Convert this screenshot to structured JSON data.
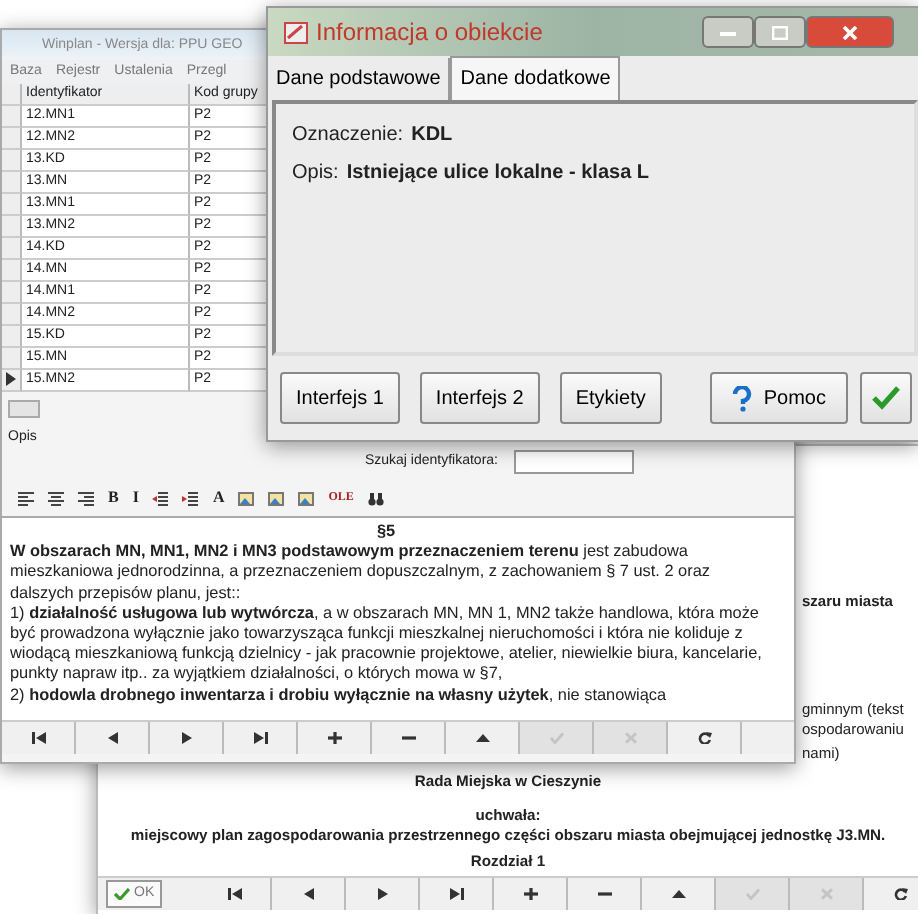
{
  "back_window": {
    "side_texts": [
      {
        "text": "szaru miasta",
        "bold": true
      },
      {
        "text": "gminnym (tekst",
        "bold": false
      },
      {
        "text": "ospodarowaniu",
        "bold": false
      },
      {
        "text": "nami)",
        "bold": false
      }
    ],
    "heading": "Rada Miejska w Cieszynie",
    "resolution_label": "uchwała:",
    "resolution_title": "miejscowy plan zagospodarowania przestrzennego części obszaru miasta obejmującej jednostkę J3.MN.",
    "chapter": "Rozdział 1",
    "ok_button": "OK",
    "nav_buttons": [
      {
        "kind": "first",
        "disabled": false
      },
      {
        "kind": "prev",
        "disabled": false
      },
      {
        "kind": "next",
        "disabled": false
      },
      {
        "kind": "last",
        "disabled": false
      },
      {
        "kind": "add",
        "disabled": false
      },
      {
        "kind": "delete",
        "disabled": false
      },
      {
        "kind": "up",
        "disabled": false
      },
      {
        "kind": "confirm",
        "disabled": true
      },
      {
        "kind": "cancel",
        "disabled": true
      },
      {
        "kind": "refresh",
        "disabled": false
      }
    ]
  },
  "main_window": {
    "title": "Winplan - Wersja dla: PPU GEO",
    "menu": [
      "Baza",
      "Rejestr",
      "Ustalenia",
      "Przegl"
    ],
    "table": {
      "columns": [
        "Identyfikator",
        "Kod grupy"
      ],
      "rows": [
        {
          "cells": [
            "12.MN1",
            "P2"
          ],
          "selected": false
        },
        {
          "cells": [
            "12.MN2",
            "P2"
          ],
          "selected": false
        },
        {
          "cells": [
            "13.KD",
            "P2"
          ],
          "selected": false
        },
        {
          "cells": [
            "13.MN",
            "P2"
          ],
          "selected": false
        },
        {
          "cells": [
            "13.MN1",
            "P2"
          ],
          "selected": false
        },
        {
          "cells": [
            "13.MN2",
            "P2"
          ],
          "selected": false
        },
        {
          "cells": [
            "14.KD",
            "P2"
          ],
          "selected": false
        },
        {
          "cells": [
            "14.MN",
            "P2"
          ],
          "selected": false
        },
        {
          "cells": [
            "14.MN1",
            "P2"
          ],
          "selected": false
        },
        {
          "cells": [
            "14.MN2",
            "P2"
          ],
          "selected": false
        },
        {
          "cells": [
            "15.KD",
            "P2"
          ],
          "selected": false
        },
        {
          "cells": [
            "15.MN",
            "P2"
          ],
          "selected": false
        },
        {
          "cells": [
            "15.MN2",
            "P2"
          ],
          "selected": true
        }
      ]
    },
    "description_label": "Opis",
    "search_label": "Szukaj identyfikatora:",
    "toolbar": [
      {
        "kind": "align-left"
      },
      {
        "kind": "align-center"
      },
      {
        "kind": "align-right"
      },
      {
        "kind": "text",
        "label": "B"
      },
      {
        "kind": "text",
        "label": "I"
      },
      {
        "kind": "outdent"
      },
      {
        "kind": "indent"
      },
      {
        "kind": "text",
        "label": "A"
      },
      {
        "kind": "image"
      },
      {
        "kind": "image"
      },
      {
        "kind": "image"
      },
      {
        "kind": "text",
        "label": "OLE"
      },
      {
        "kind": "binoculars"
      }
    ],
    "document": {
      "heading": "§5",
      "paragraphs": [
        "**W obszarach MN, MN1, MN2 i MN3 podstawowym przeznaczeniem terenu** jest zabudowa mieszkaniowa jednorodzinna, a przeznaczeniem dopuszczalnym, z zachowaniem § 7 ust. 2 oraz dalszych przepisów planu, jest::",
        "1) **działalność usługowa lub wytwórcza**, a w obszarach MN, MN 1, MN2 także handlowa, która może być prowadzona wyłącznie jako towarzysząca funkcji mieszkalnej nieruchomości i która nie koliduje z wiodącą mieszkaniową funkcją dzielnicy - jak pracownie projektowe, atelier, niewielkie biura, kancelarie, punkty napraw itp.. za wyjątkiem działalności, o których mowa w §7,",
        "2) **hodowla drobnego inwentarza i drobiu wyłącznie na własny użytek**, nie stanowiąca"
      ]
    },
    "nav_buttons": [
      {
        "kind": "first",
        "disabled": false
      },
      {
        "kind": "prev",
        "disabled": false
      },
      {
        "kind": "next",
        "disabled": false
      },
      {
        "kind": "last",
        "disabled": false
      },
      {
        "kind": "add",
        "disabled": false
      },
      {
        "kind": "delete",
        "disabled": false
      },
      {
        "kind": "up",
        "disabled": false
      },
      {
        "kind": "confirm",
        "disabled": true
      },
      {
        "kind": "cancel",
        "disabled": true
      },
      {
        "kind": "refresh",
        "disabled": false
      }
    ]
  },
  "info_dialog": {
    "title": "Informacja o obiekcie",
    "tabs": [
      {
        "label": "Dane podstawowe",
        "selected": false
      },
      {
        "label": "Dane dodatkowe",
        "selected": true
      }
    ],
    "fields": [
      {
        "label": "Oznaczenie:",
        "value": "KDL"
      },
      {
        "label": "Opis:",
        "value": "Istniejące ulice lokalne - klasa L"
      }
    ],
    "buttons": [
      {
        "kind": "plain",
        "label": "Interfejs 1"
      },
      {
        "kind": "plain",
        "label": "Interfejs 2"
      },
      {
        "kind": "plain",
        "label": "Etykiety"
      },
      {
        "kind": "help",
        "label": "Pomoc"
      },
      {
        "kind": "ok"
      }
    ]
  }
}
